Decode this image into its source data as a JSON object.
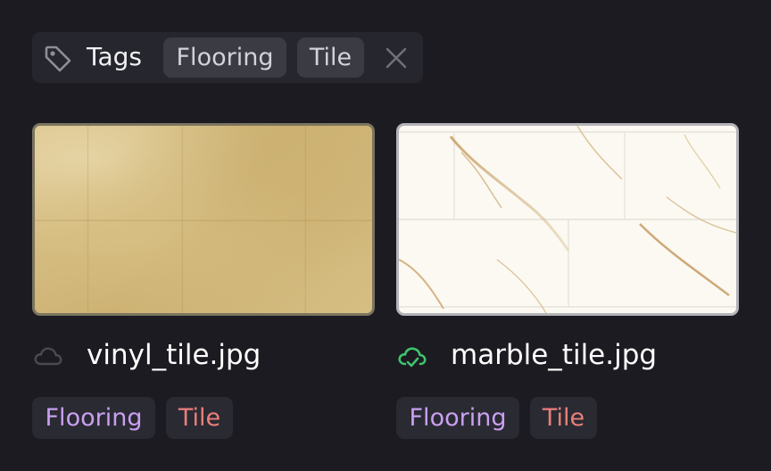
{
  "filter": {
    "label": "Tags",
    "icon": "tag-icon",
    "chips": [
      "Flooring",
      "Tile"
    ],
    "clear_icon": "close-icon"
  },
  "files": [
    {
      "name": "vinyl_tile.jpg",
      "sync_status": "not-synced",
      "status_icon": "cloud-icon",
      "tags": [
        "Flooring",
        "Tile"
      ]
    },
    {
      "name": "marble_tile.jpg",
      "sync_status": "synced",
      "status_icon": "cloud-check-icon",
      "tags": [
        "Flooring",
        "Tile"
      ]
    }
  ],
  "colors": {
    "background": "#1c1b21",
    "flooring_tag": "#c9a0f0",
    "tile_tag": "#ea7f78",
    "synced": "#3ec46d"
  }
}
